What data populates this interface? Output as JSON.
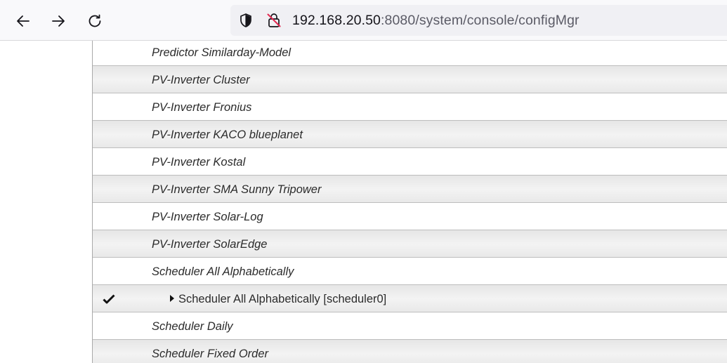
{
  "browser": {
    "icons": {
      "back": "arrow-left-icon",
      "forward": "arrow-right-icon",
      "reload": "reload-icon",
      "tracking": "shield-icon",
      "insecure": "insecure-lock-icon"
    },
    "url": {
      "host": "192.168.20.50",
      "path": ":8080/system/console/configMgr"
    }
  },
  "config_list": {
    "rows": [
      {
        "label": "Predictor Similarday-Model",
        "type": "factory"
      },
      {
        "label": "PV-Inverter Cluster",
        "type": "factory"
      },
      {
        "label": "PV-Inverter Fronius",
        "type": "factory"
      },
      {
        "label": "PV-Inverter KACO blueplanet",
        "type": "factory"
      },
      {
        "label": "PV-Inverter Kostal",
        "type": "factory"
      },
      {
        "label": "PV-Inverter SMA Sunny Tripower",
        "type": "factory"
      },
      {
        "label": "PV-Inverter Solar-Log",
        "type": "factory"
      },
      {
        "label": "PV-Inverter SolarEdge",
        "type": "factory"
      },
      {
        "label": "Scheduler All Alphabetically",
        "type": "factory"
      },
      {
        "label": "Scheduler All Alphabetically [scheduler0]",
        "type": "instance",
        "icons": [
          "check-icon",
          "expand-triangle-icon"
        ]
      },
      {
        "label": "Scheduler Daily",
        "type": "factory"
      },
      {
        "label": "Scheduler Fixed Order",
        "type": "factory"
      }
    ]
  }
}
